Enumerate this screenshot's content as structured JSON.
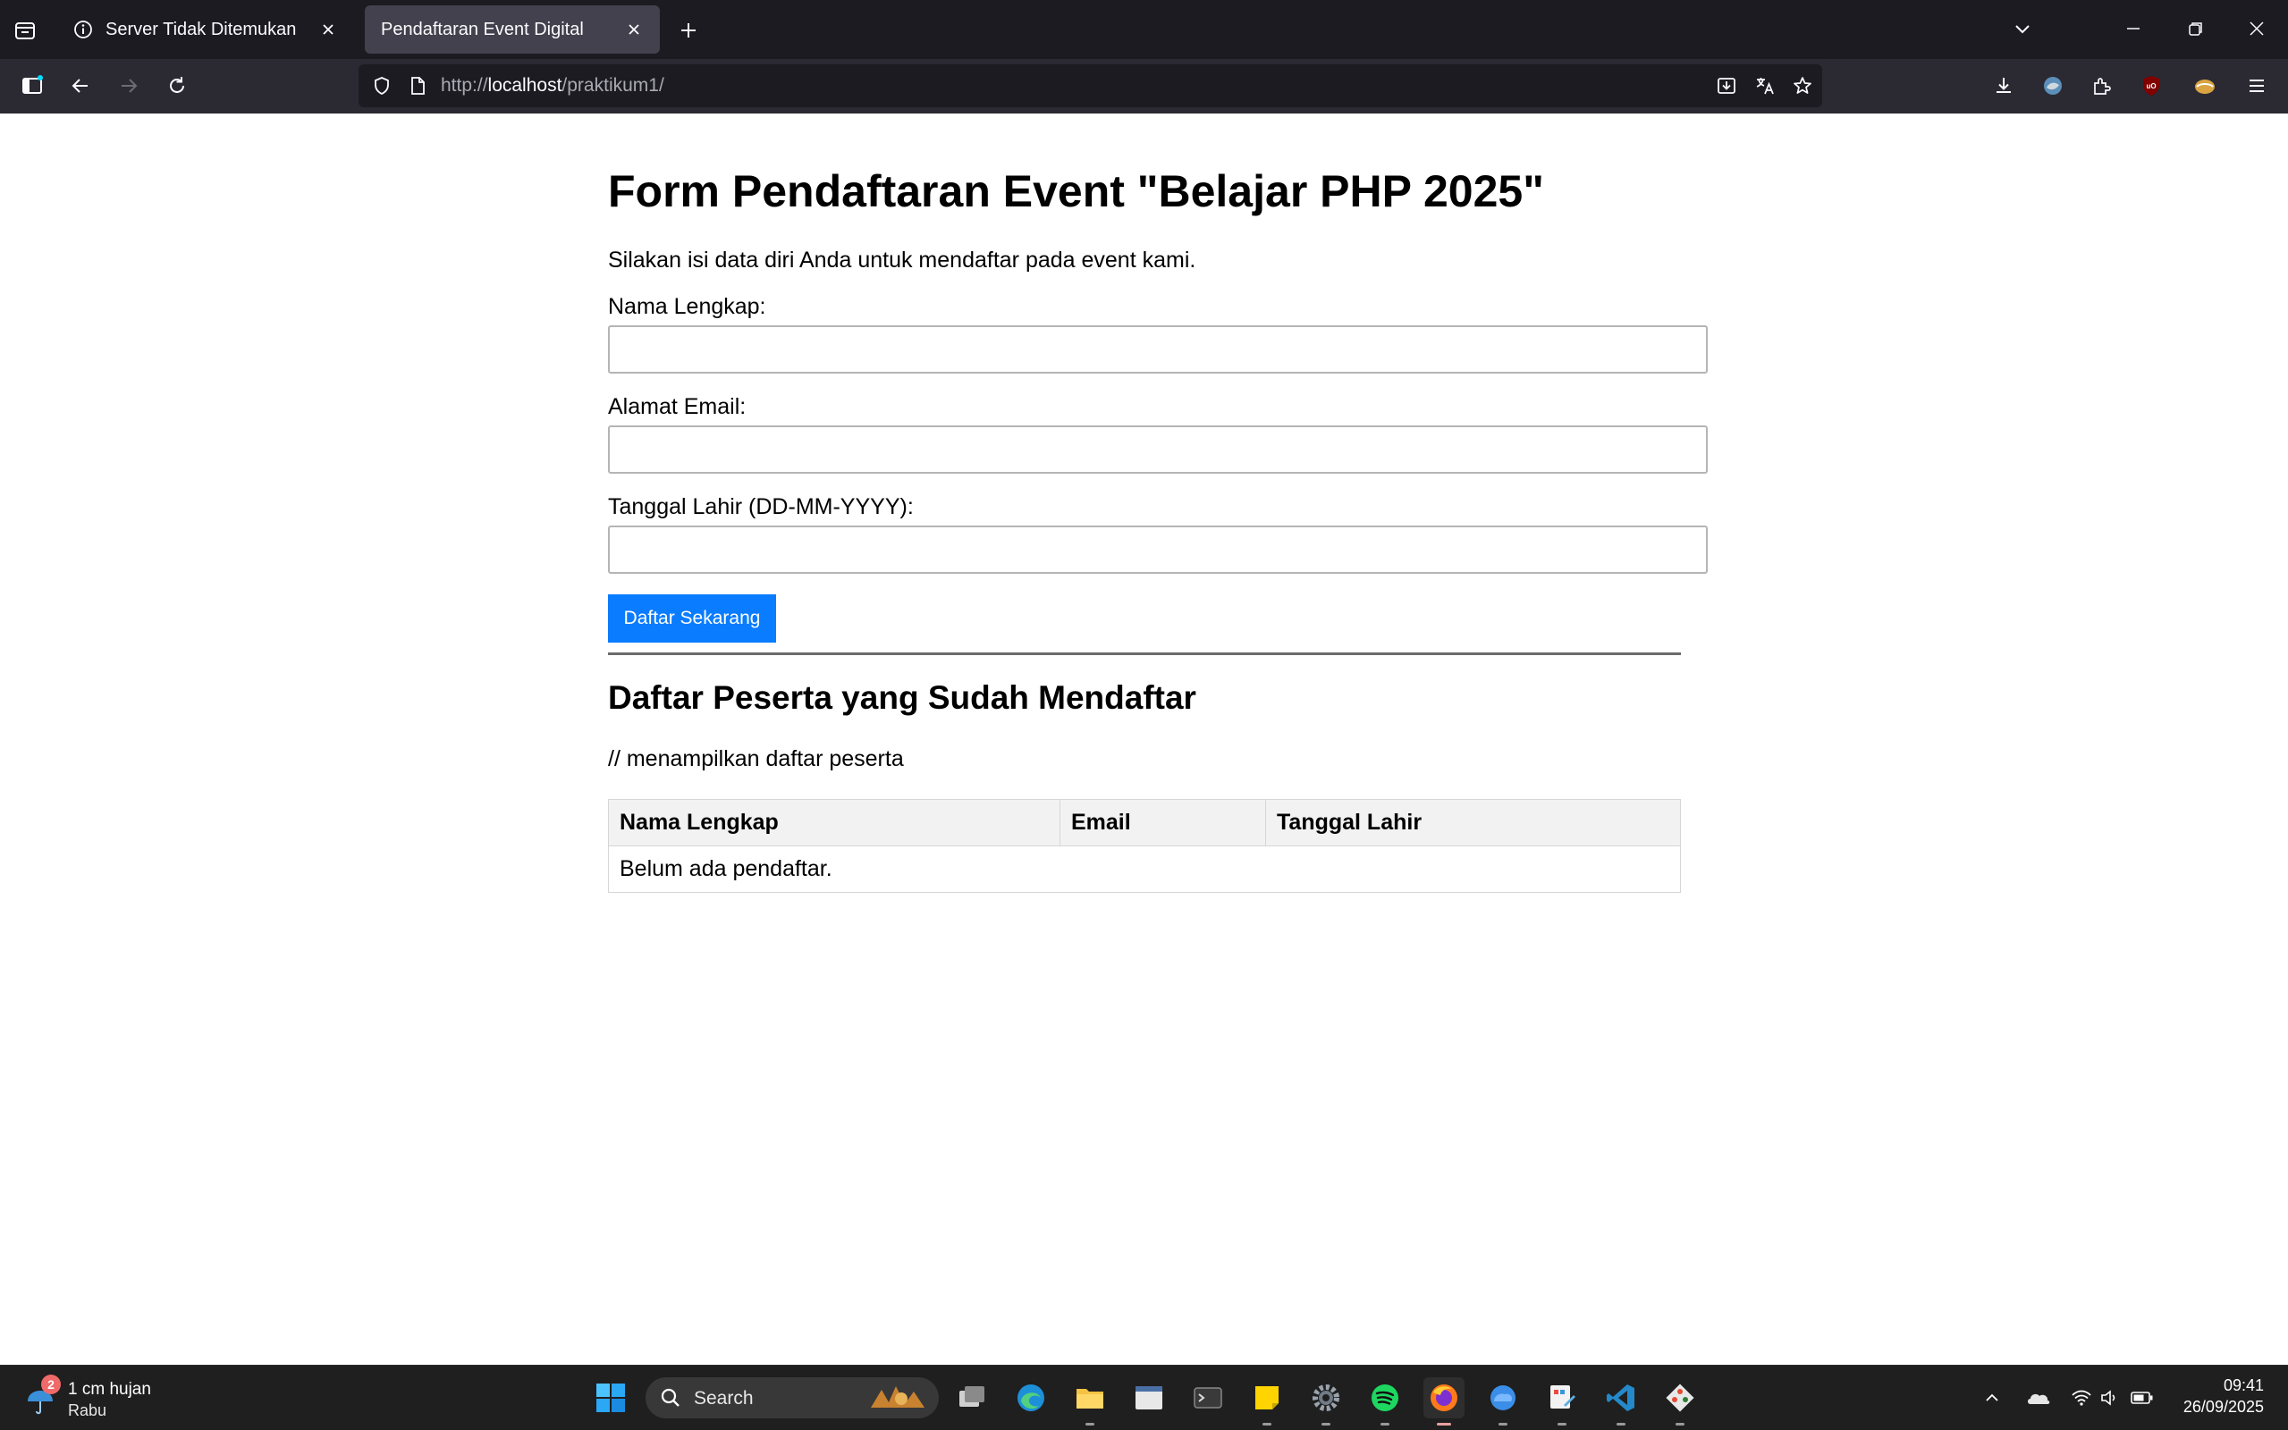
{
  "browser": {
    "tabs": [
      {
        "title": "Server Tidak Ditemukan",
        "active": false
      },
      {
        "title": "Pendaftaran Event Digital",
        "active": true
      }
    ],
    "url": {
      "scheme": "http://",
      "host": "localhost",
      "path": "/praktikum1/"
    }
  },
  "page": {
    "heading": "Form Pendaftaran Event \"Belajar PHP 2025\"",
    "intro": "Silakan isi data diri Anda untuk mendaftar pada event kami.",
    "form": {
      "name_label": "Nama Lengkap:",
      "name_value": "",
      "email_label": "Alamat Email:",
      "email_value": "",
      "birth_label": "Tanggal Lahir (DD-MM-YYYY):",
      "birth_value": "",
      "submit_label": "Daftar Sekarang"
    },
    "participants": {
      "title": "Daftar Peserta yang Sudah Mendaftar",
      "note": "// menampilkan daftar peserta",
      "columns": [
        "Nama Lengkap",
        "Email",
        "Tanggal Lahir"
      ],
      "empty_message": "Belum ada pendaftar."
    }
  },
  "taskbar": {
    "weather": {
      "badge": "2",
      "line1": "1 cm hujan",
      "line2": "Rabu"
    },
    "search_label": "Search",
    "clock": {
      "time": "09:41",
      "date": "26/09/2025"
    },
    "apps": [
      "windows-start-icon",
      "task-view-icon",
      "edge-icon",
      "file-explorer-icon",
      "app-window-icon",
      "terminal-icon",
      "sticky-notes-icon",
      "settings-icon",
      "spotify-icon",
      "firefox-icon",
      "cloud-app-icon",
      "paint-icon",
      "vscode-icon",
      "git-icon"
    ]
  },
  "colors": {
    "accent": "#0a7cff",
    "chrome_dark": "#1c1b22",
    "toolbar": "#2b2a33",
    "active_tab": "#42414d",
    "taskbar": "#1f1f1f"
  }
}
